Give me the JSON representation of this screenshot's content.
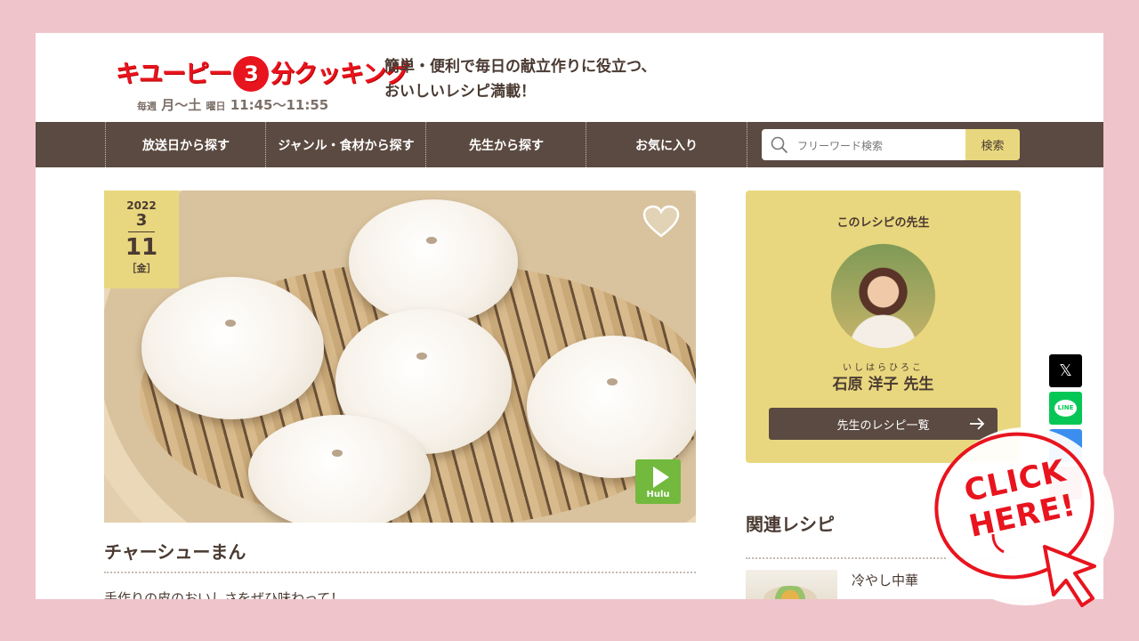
{
  "header": {
    "logo": {
      "word_before": "キユーピー",
      "number": "3",
      "word_after": "分クッキング",
      "schedule_prefix": "毎週",
      "schedule_days": "月〜土",
      "schedule_mid": "曜日",
      "schedule_time": "11:45〜11:55"
    },
    "tagline": "簡単・便利で毎日の献立作りに役立つ、\nおいしいレシピ満載！"
  },
  "nav": {
    "items": [
      "放送日から探す",
      "ジャンル・食材から探す",
      "先生から探す",
      "お気に入り"
    ],
    "search_placeholder": "フリーワード検索",
    "search_button": "検索"
  },
  "recipe": {
    "date": {
      "year": "2022",
      "month": "3",
      "day": "11",
      "weekday": "［金］"
    },
    "hulu_label": "Hulu",
    "title": "チャーシューまん",
    "lead": "手作りの皮のおいしさをぜひ味わって！"
  },
  "teacher_card": {
    "heading": "このレシピの先生",
    "name_ruby": "いしはらひろこ",
    "name": "石原 洋子 先生",
    "button_label": "先生のレシピ一覧"
  },
  "related": {
    "heading": "関連レシピ",
    "items": [
      {
        "title": "冷やし中華"
      }
    ]
  },
  "share": {
    "x_label": "𝕏",
    "line_label": "LINE"
  },
  "overlay": {
    "text": "CLICK\nHERE!"
  },
  "colors": {
    "background": "#f0c4cb",
    "nav": "#5b4a41",
    "accent_yellow": "#e8d77e",
    "brand_red": "#e8141e",
    "hulu_green": "#72b93d"
  }
}
